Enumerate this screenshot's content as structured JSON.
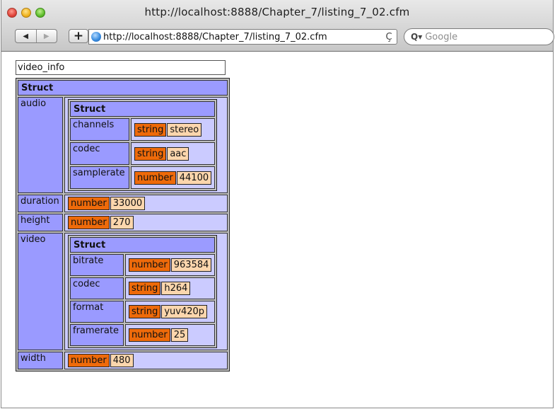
{
  "browser": {
    "window_title": "http://localhost:8888/Chapter_7/listing_7_02.cfm",
    "url": "http://localhost:8888/Chapter_7/listing_7_02.cfm",
    "back_glyph": "◀",
    "forward_glyph": "▶",
    "add_glyph": "+",
    "reload_glyph": "Ç",
    "search_placeholder": "Google",
    "search_glyph": "Q▾"
  },
  "dump": {
    "title": "video_info",
    "struct_label": "Struct",
    "audio": {
      "key": "audio",
      "header": "Struct",
      "channels": {
        "key": "channels",
        "type": "string",
        "value": "stereo"
      },
      "codec": {
        "key": "codec",
        "type": "string",
        "value": "aac"
      },
      "samplerate": {
        "key": "samplerate",
        "type": "number",
        "value": "44100"
      }
    },
    "duration": {
      "key": "duration",
      "type": "number",
      "value": "33000"
    },
    "height": {
      "key": "height",
      "type": "number",
      "value": "270"
    },
    "video": {
      "key": "video",
      "header": "Struct",
      "bitrate": {
        "key": "bitrate",
        "type": "number",
        "value": "963584"
      },
      "codec": {
        "key": "codec",
        "type": "string",
        "value": "h264"
      },
      "format": {
        "key": "format",
        "type": "string",
        "value": "yuv420p"
      },
      "framerate": {
        "key": "framerate",
        "type": "number",
        "value": "25"
      }
    },
    "width": {
      "key": "width",
      "type": "number",
      "value": "480"
    }
  },
  "colors": {
    "struct_header": "#9b9bff",
    "struct_key": "#9a9aff",
    "struct_value": "#cbcbff",
    "type_label": "#ee6a0a",
    "type_value": "#fcd6ad"
  }
}
